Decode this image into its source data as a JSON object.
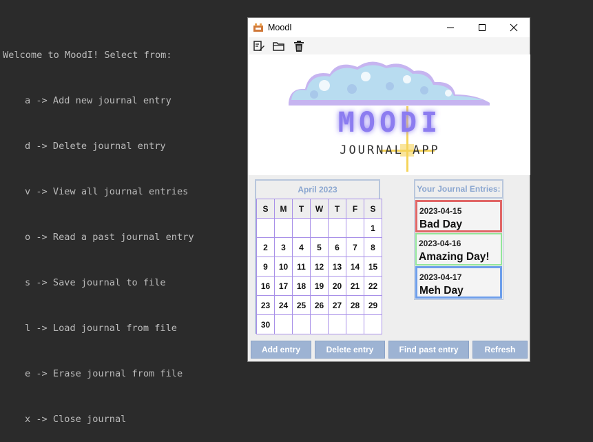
{
  "console": {
    "lines": [
      "Welcome to MoodI! Select from:",
      "a -> Add new journal entry",
      "d -> Delete journal entry",
      "v -> View all journal entries",
      "o -> Read a past journal entry",
      "s -> Save journal to file",
      "l -> Load journal from file",
      "e -> Erase journal from file",
      "x -> Close journal"
    ]
  },
  "window": {
    "title": "MoodI",
    "controls": [
      "minimize-icon",
      "maximize-icon",
      "close-icon"
    ],
    "toolbar_icons": [
      "edit-icon",
      "folder-icon",
      "trash-icon"
    ]
  },
  "banner": {
    "logo_text": "MOODI",
    "subtitle": "JOURNAL APP",
    "colors": {
      "cloud": "#b8dcf0",
      "cloud_shadow": "#c6b4f0",
      "logo": "#8c7cf0",
      "spark": "#f5d45a"
    }
  },
  "calendar": {
    "title": "April 2023",
    "weekdays": [
      "S",
      "M",
      "T",
      "W",
      "T",
      "F",
      "S"
    ],
    "weeks": [
      [
        "",
        "",
        "",
        "",
        "",
        "",
        "1"
      ],
      [
        "2",
        "3",
        "4",
        "5",
        "6",
        "7",
        "8"
      ],
      [
        "9",
        "10",
        "11",
        "12",
        "13",
        "14",
        "15"
      ],
      [
        "16",
        "17",
        "18",
        "19",
        "20",
        "21",
        "22"
      ],
      [
        "23",
        "24",
        "25",
        "26",
        "27",
        "28",
        "29"
      ],
      [
        "30",
        "",
        "",
        "",
        "",
        "",
        ""
      ]
    ]
  },
  "entries": {
    "title": "Your Journal Entries:",
    "items": [
      {
        "date": "2023-04-15",
        "title": "Bad Day",
        "color": "#e06666"
      },
      {
        "date": "2023-04-16",
        "title": "Amazing Day!",
        "color": "#93e69a"
      },
      {
        "date": "2023-04-17",
        "title": "Meh Day",
        "color": "#6d9eeb"
      }
    ]
  },
  "buttons": {
    "add": "Add entry",
    "delete": "Delete entry",
    "find": "Find past entry",
    "refresh": "Refresh"
  }
}
